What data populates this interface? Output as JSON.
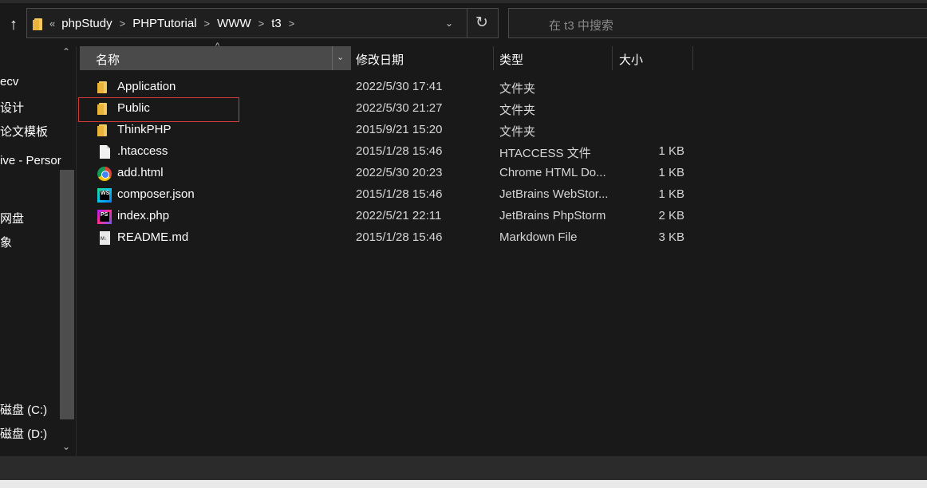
{
  "address_bar": {
    "overflow": "«",
    "crumbs": [
      "phpStudy",
      "PHPTutorial",
      "WWW",
      "t3"
    ],
    "chevron": ">",
    "dropdown": "⌄",
    "refresh": "↻"
  },
  "up_arrow": "↑",
  "search": {
    "placeholder": "在 t3 中搜索"
  },
  "nav": {
    "items": [
      "ecv",
      "设计",
      "论文模板",
      "ive - Persor",
      "网盘",
      "象",
      "磁盘 (C:)",
      "磁盘 (D:)"
    ],
    "scroll_up": "⌃",
    "scroll_down": "⌄"
  },
  "columns": {
    "name": "名称",
    "modified": "修改日期",
    "type": "类型",
    "size": "大小",
    "sort_arrow": "^",
    "chevron": "⌄"
  },
  "files": [
    {
      "name": "Application",
      "modified": "2022/5/30 17:41",
      "type": "文件夹",
      "size": "",
      "icon": "folder-icon"
    },
    {
      "name": "Public",
      "modified": "2022/5/30 21:27",
      "type": "文件夹",
      "size": "",
      "icon": "folder-icon"
    },
    {
      "name": "ThinkPHP",
      "modified": "2015/9/21 15:20",
      "type": "文件夹",
      "size": "",
      "icon": "folder-icon"
    },
    {
      "name": ".htaccess",
      "modified": "2015/1/28 15:46",
      "type": "HTACCESS 文件",
      "size": "1 KB",
      "icon": "blank-file-icon"
    },
    {
      "name": "add.html",
      "modified": "2022/5/30 20:23",
      "type": "Chrome HTML Do...",
      "size": "1 KB",
      "icon": "chrome-icon"
    },
    {
      "name": "composer.json",
      "modified": "2015/1/28 15:46",
      "type": "JetBrains WebStor...",
      "size": "1 KB",
      "icon": "webstorm-icon"
    },
    {
      "name": "index.php",
      "modified": "2022/5/21 22:11",
      "type": "JetBrains PhpStorm",
      "size": "2 KB",
      "icon": "phpstorm-icon"
    },
    {
      "name": "README.md",
      "modified": "2015/1/28 15:46",
      "type": "Markdown File",
      "size": "3 KB",
      "icon": "markdown-icon"
    }
  ],
  "icon_labels": {
    "webstorm": "WS",
    "phpstorm": "PS",
    "markdown": "M↓"
  },
  "colors": {
    "background": "#191919",
    "header_active": "#4a4a4a",
    "folder": "#f4c95d",
    "selection_outline": "#d23a3a",
    "scrollbar_thumb": "#4d4d4d"
  }
}
